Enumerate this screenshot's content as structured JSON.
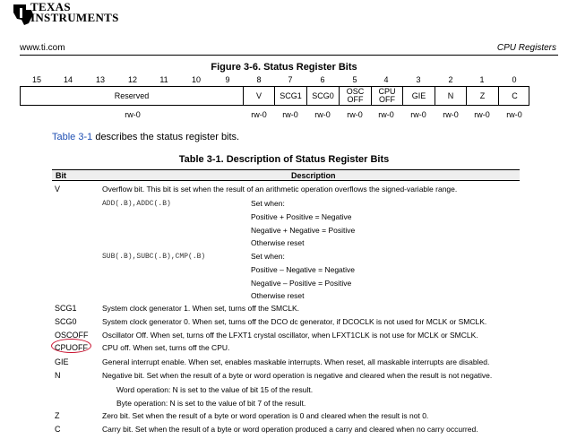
{
  "header": {
    "brand_line1": "TEXAS",
    "brand_line2": "INSTRUMENTS",
    "url": "www.ti.com",
    "section": "CPU Registers"
  },
  "figure": {
    "title": "Figure 3-6. Status Register Bits",
    "bit_numbers": [
      "15",
      "14",
      "13",
      "12",
      "11",
      "10",
      "9",
      "8",
      "7",
      "6",
      "5",
      "4",
      "3",
      "2",
      "1",
      "0"
    ],
    "fields": [
      {
        "label": "Reserved"
      },
      {
        "label": "V"
      },
      {
        "label": "SCG1"
      },
      {
        "label": "SCG0"
      },
      {
        "label": "OSC\nOFF"
      },
      {
        "label": "CPU\nOFF"
      },
      {
        "label": "GIE"
      },
      {
        "label": "N"
      },
      {
        "label": "Z"
      },
      {
        "label": "C"
      }
    ],
    "access": [
      "rw-0",
      "rw-0",
      "rw-0",
      "rw-0",
      "rw-0",
      "rw-0",
      "rw-0",
      "rw-0",
      "rw-0",
      "rw-0"
    ]
  },
  "intro": {
    "link": "Table 3-1",
    "text": " describes the status register bits."
  },
  "table": {
    "title": "Table 3-1. Description of Status Register Bits",
    "col_bit": "Bit",
    "col_desc": "Description",
    "rows": [
      {
        "bit": "V",
        "desc": "Overflow bit. This bit is set when the result of an arithmetic operation overflows the signed-variable range."
      },
      {
        "bit": "SCG1",
        "desc": "System clock generator 1. When set, turns off the SMCLK."
      },
      {
        "bit": "SCG0",
        "desc": "System clock generator 0. When set, turns off the DCO dc generator, if DCOCLK is not used for MCLK or SMCLK."
      },
      {
        "bit": "OSCOFF",
        "desc": "Oscillator Off. When set, turns off the LFXT1 crystal oscillator, when LFXT1CLK is not use for MCLK or SMCLK."
      },
      {
        "bit": "CPUOFF",
        "desc": "CPU off. When set, turns off the CPU."
      },
      {
        "bit": "GIE",
        "desc": "General interrupt enable. When set, enables maskable interrupts. When reset, all maskable interrupts are disabled."
      },
      {
        "bit": "N",
        "desc": "Negative bit. Set when the result of a byte or word operation is negative and cleared when the result is not negative."
      },
      {
        "bit": "Z",
        "desc": "Zero bit. Set when the result of a byte or word operation is 0 and cleared when the result is not 0."
      },
      {
        "bit": "C",
        "desc": "Carry bit. Set when the result of a byte or word operation produced a carry and cleared when no carry occurred."
      }
    ],
    "v_details": {
      "add_instr": "ADD(.B),ADDC(.B)",
      "add_lines": [
        "Set when:",
        "Positive + Positive = Negative",
        "Negative + Negative = Positive",
        "Otherwise reset"
      ],
      "sub_instr": "SUB(.B),SUBC(.B),CMP(.B)",
      "sub_lines": [
        "Set when:",
        "Positive – Negative = Negative",
        "Negative – Positive = Positive",
        "Otherwise reset"
      ]
    },
    "n_details": [
      "Word operation: N is set to the value of bit 15 of the result.",
      "Byte operation: N is set to the value of bit 7 of the result."
    ]
  },
  "colors": {
    "link": "#1f4fb3",
    "highlight": "#c8102e",
    "logo": "#000000"
  }
}
